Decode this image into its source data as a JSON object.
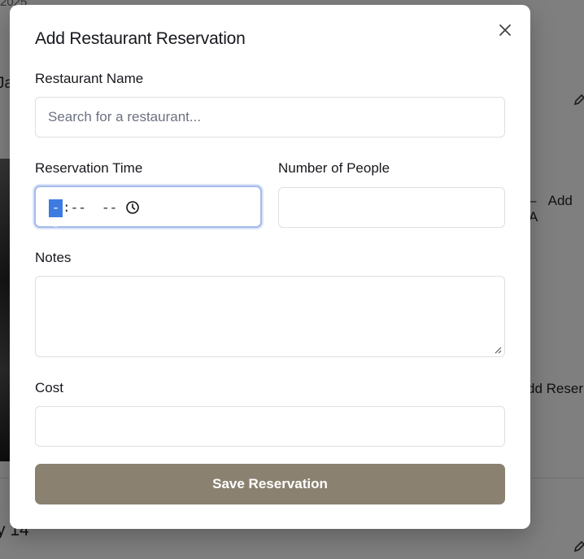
{
  "background": {
    "top_fragment": "2025",
    "left_fragment": "Ja",
    "right_fragment_1": "Add A",
    "right_fragment_2": "dd Reser",
    "bottom_fragment": "y 14"
  },
  "modal": {
    "title": "Add Restaurant Reservation",
    "close_icon": "close-icon",
    "restaurant_name": {
      "label": "Restaurant Name",
      "placeholder": "Search for a restaurant...",
      "value": ""
    },
    "reservation_time": {
      "label": "Reservation Time",
      "hour_segment": "--",
      "rest_segments": ":--  --",
      "icon": "clock-icon"
    },
    "number_of_people": {
      "label": "Number of People",
      "value": ""
    },
    "notes": {
      "label": "Notes",
      "value": ""
    },
    "cost": {
      "label": "Cost",
      "value": ""
    },
    "save_label": "Save Reservation"
  },
  "colors": {
    "save_button": "#8b8170",
    "focus_ring": "#a3b9e8",
    "time_selection": "#3d7be0",
    "overlay": "rgba(0,0,0,0.5)"
  }
}
